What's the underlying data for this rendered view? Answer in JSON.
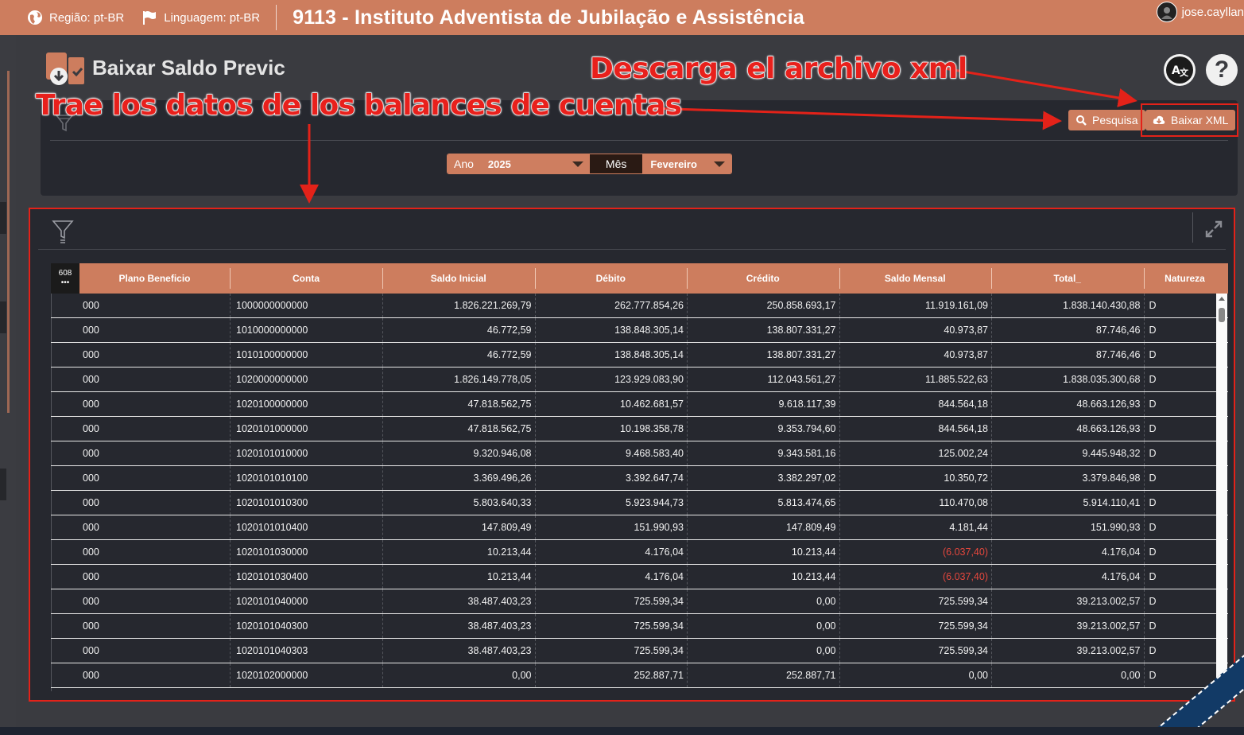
{
  "topbar": {
    "region": "Região: pt-BR",
    "language": "Linguagem: pt-BR",
    "app_title": "9113 - Instituto Adventista de Jubilação e Assistência",
    "user": "jose.cayllan"
  },
  "page": {
    "title": "Baixar Saldo Previc"
  },
  "filters": {
    "search_label": "Pesquisa",
    "download_label": "Baixar XML",
    "year_label": "Ano",
    "year_value": "2025",
    "month_label": "Mês",
    "month_value": "Fevereiro"
  },
  "annotations": {
    "download_note": "Descarga el archivo xml",
    "fetch_note": "Trae los datos de los balances de cuentas"
  },
  "grid": {
    "record_count": "608",
    "record_dots": "•••",
    "columns": [
      "Plano Beneficio",
      "Conta",
      "Saldo Inicial",
      "Débito",
      "Crédito",
      "Saldo Mensal",
      "Total_",
      "Natureza"
    ],
    "rows": [
      {
        "plano": "000",
        "conta": "1000000000000",
        "saldo_inicial": "1.826.221.269,79",
        "debito": "262.777.854,26",
        "credito": "250.858.693,17",
        "saldo_mensal": "11.919.161,09",
        "total": "1.838.140.430,88",
        "natureza": "D"
      },
      {
        "plano": "000",
        "conta": "1010000000000",
        "saldo_inicial": "46.772,59",
        "debito": "138.848.305,14",
        "credito": "138.807.331,27",
        "saldo_mensal": "40.973,87",
        "total": "87.746,46",
        "natureza": "D"
      },
      {
        "plano": "000",
        "conta": "1010100000000",
        "saldo_inicial": "46.772,59",
        "debito": "138.848.305,14",
        "credito": "138.807.331,27",
        "saldo_mensal": "40.973,87",
        "total": "87.746,46",
        "natureza": "D"
      },
      {
        "plano": "000",
        "conta": "1020000000000",
        "saldo_inicial": "1.826.149.778,05",
        "debito": "123.929.083,90",
        "credito": "112.043.561,27",
        "saldo_mensal": "11.885.522,63",
        "total": "1.838.035.300,68",
        "natureza": "D"
      },
      {
        "plano": "000",
        "conta": "1020100000000",
        "saldo_inicial": "47.818.562,75",
        "debito": "10.462.681,57",
        "credito": "9.618.117,39",
        "saldo_mensal": "844.564,18",
        "total": "48.663.126,93",
        "natureza": "D"
      },
      {
        "plano": "000",
        "conta": "1020101000000",
        "saldo_inicial": "47.818.562,75",
        "debito": "10.198.358,78",
        "credito": "9.353.794,60",
        "saldo_mensal": "844.564,18",
        "total": "48.663.126,93",
        "natureza": "D"
      },
      {
        "plano": "000",
        "conta": "1020101010000",
        "saldo_inicial": "9.320.946,08",
        "debito": "9.468.583,40",
        "credito": "9.343.581,16",
        "saldo_mensal": "125.002,24",
        "total": "9.445.948,32",
        "natureza": "D"
      },
      {
        "plano": "000",
        "conta": "1020101010100",
        "saldo_inicial": "3.369.496,26",
        "debito": "3.392.647,74",
        "credito": "3.382.297,02",
        "saldo_mensal": "10.350,72",
        "total": "3.379.846,98",
        "natureza": "D"
      },
      {
        "plano": "000",
        "conta": "1020101010300",
        "saldo_inicial": "5.803.640,33",
        "debito": "5.923.944,73",
        "credito": "5.813.474,65",
        "saldo_mensal": "110.470,08",
        "total": "5.914.110,41",
        "natureza": "D"
      },
      {
        "plano": "000",
        "conta": "1020101010400",
        "saldo_inicial": "147.809,49",
        "debito": "151.990,93",
        "credito": "147.809,49",
        "saldo_mensal": "4.181,44",
        "total": "151.990,93",
        "natureza": "D"
      },
      {
        "plano": "000",
        "conta": "1020101030000",
        "saldo_inicial": "10.213,44",
        "debito": "4.176,04",
        "credito": "10.213,44",
        "saldo_mensal": "(6.037,40)",
        "saldo_mensal_negative": true,
        "total": "4.176,04",
        "natureza": "D"
      },
      {
        "plano": "000",
        "conta": "1020101030400",
        "saldo_inicial": "10.213,44",
        "debito": "4.176,04",
        "credito": "10.213,44",
        "saldo_mensal": "(6.037,40)",
        "saldo_mensal_negative": true,
        "total": "4.176,04",
        "natureza": "D"
      },
      {
        "plano": "000",
        "conta": "1020101040000",
        "saldo_inicial": "38.487.403,23",
        "debito": "725.599,34",
        "credito": "0,00",
        "saldo_mensal": "725.599,34",
        "total": "39.213.002,57",
        "natureza": "D"
      },
      {
        "plano": "000",
        "conta": "1020101040300",
        "saldo_inicial": "38.487.403,23",
        "debito": "725.599,34",
        "credito": "0,00",
        "saldo_mensal": "725.599,34",
        "total": "39.213.002,57",
        "natureza": "D"
      },
      {
        "plano": "000",
        "conta": "1020101040303",
        "saldo_inicial": "38.487.403,23",
        "debito": "725.599,34",
        "credito": "0,00",
        "saldo_mensal": "725.599,34",
        "total": "39.213.002,57",
        "natureza": "D"
      },
      {
        "plano": "000",
        "conta": "1020102000000",
        "saldo_inicial": "0,00",
        "debito": "252.887,71",
        "credito": "252.887,71",
        "saldo_mensal": "0,00",
        "total": "0,00",
        "natureza": "D"
      }
    ]
  },
  "colors": {
    "accent": "#cd7d5e",
    "panel": "#26282f",
    "background": "#3a3b40",
    "negative": "#e4473d",
    "annotation": "#e32219"
  }
}
